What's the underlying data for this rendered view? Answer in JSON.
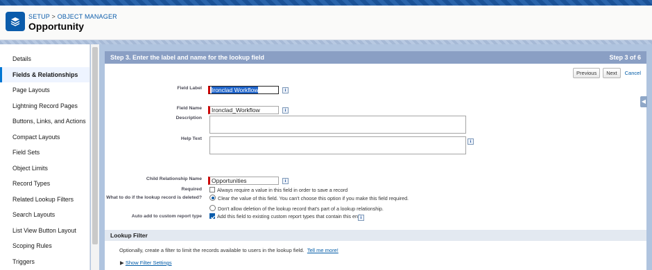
{
  "header": {
    "breadcrumb_setup": "SETUP",
    "breadcrumb_sep": " > ",
    "breadcrumb_object_manager": "OBJECT MANAGER",
    "title": "Opportunity"
  },
  "sidebar": {
    "items": [
      {
        "label": "Details"
      },
      {
        "label": "Fields & Relationships"
      },
      {
        "label": "Page Layouts"
      },
      {
        "label": "Lightning Record Pages"
      },
      {
        "label": "Buttons, Links, and Actions"
      },
      {
        "label": "Compact Layouts"
      },
      {
        "label": "Field Sets"
      },
      {
        "label": "Object Limits"
      },
      {
        "label": "Record Types"
      },
      {
        "label": "Related Lookup Filters"
      },
      {
        "label": "Search Layouts"
      },
      {
        "label": "List View Button Layout"
      },
      {
        "label": "Scoping Rules"
      },
      {
        "label": "Triggers"
      }
    ],
    "active_index": 1
  },
  "step": {
    "title": "Step 3. Enter the label and name for the lookup field",
    "progress": "Step 3 of 6"
  },
  "buttons": {
    "previous": "Previous",
    "next": "Next",
    "cancel": "Cancel"
  },
  "form": {
    "field_label_label": "Field Label",
    "field_label_value": "Ironclad Workflow",
    "field_name_label": "Field Name",
    "field_name_value": "Ironclad_Workflow",
    "description_label": "Description",
    "help_text_label": "Help Text",
    "child_rel_label": "Child Relationship Name",
    "child_rel_value": "Opportunities",
    "required_label": "Required",
    "required_text": "Always require a value in this field in order to save a record",
    "delete_label": "What to do if the lookup record is deleted?",
    "delete_opt1": "Clear the value of this field. You can't choose this option if you make this field required.",
    "delete_opt2": "Don't allow deletion of the lookup record that's part of a lookup relationship.",
    "auto_add_label": "Auto add to custom report type",
    "auto_add_text": "Add this field to existing custom report types that contain this entity",
    "info_glyph": "i"
  },
  "lookup_filter": {
    "title": "Lookup Filter",
    "desc": "Optionally, create a filter to limit the records available to users in the lookup field.",
    "tell_me_more": "Tell me more!",
    "show_filter": "Show Filter Settings"
  }
}
